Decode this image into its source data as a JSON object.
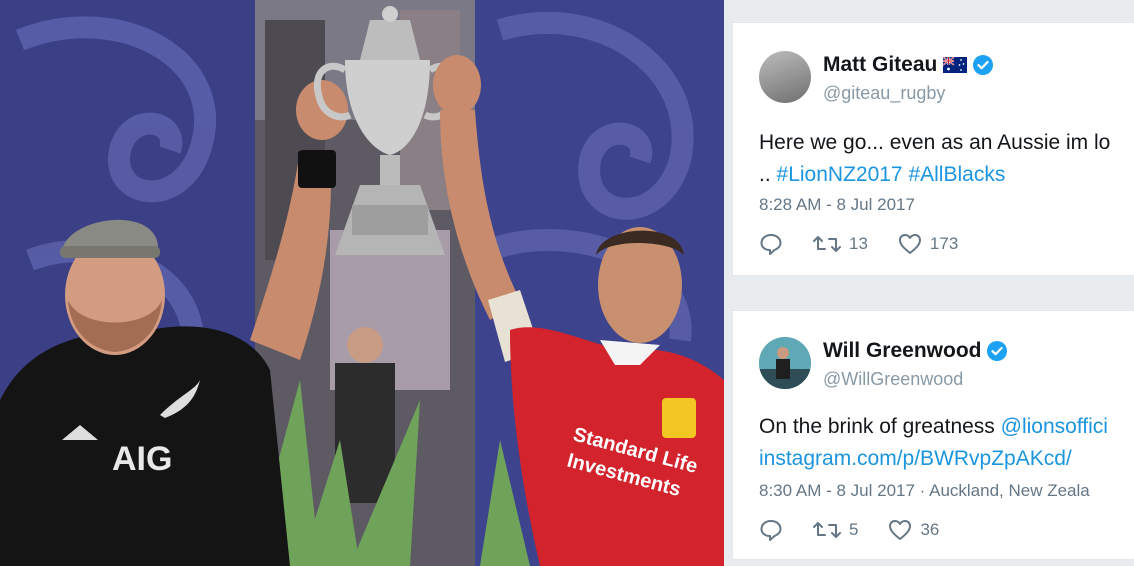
{
  "tweets": [
    {
      "display_name": "Matt Giteau",
      "handle": "@giteau_rugby",
      "text_prefix": "Here we go... even as an Aussie im lo",
      "text_line2_prefix": "..",
      "hashtag_1": "#LionNZ2017",
      "hashtag_2": "#AllBlacks",
      "meta": "8:28 AM - 8 Jul 2017",
      "retweets": "13",
      "likes": "173",
      "flag_icon": "australia-flag-icon",
      "verified_icon": "verified-badge-icon"
    },
    {
      "display_name": "Will Greenwood",
      "handle": "@WillGreenwood",
      "text_prefix": "On the brink of greatness ",
      "mention": "@lionsoffici",
      "link": "instagram.com/p/BWRvpZpAKcd/",
      "meta": "8:30 AM - 8 Jul 2017 · Auckland, New Zeala",
      "retweets": "5",
      "likes": "36",
      "verified_icon": "verified-badge-icon"
    }
  ],
  "photo": {
    "left_shirt_sponsor": "AIG",
    "right_shirt_sponsor_line1": "Standard Life",
    "right_shirt_sponsor_line2": "Investments"
  },
  "colors": {
    "link": "#1b95e0",
    "verified": "#1da1f2",
    "lions_red": "#d3232c",
    "all_blacks": "#111111",
    "backdrop_blue": "#3a3f86"
  }
}
